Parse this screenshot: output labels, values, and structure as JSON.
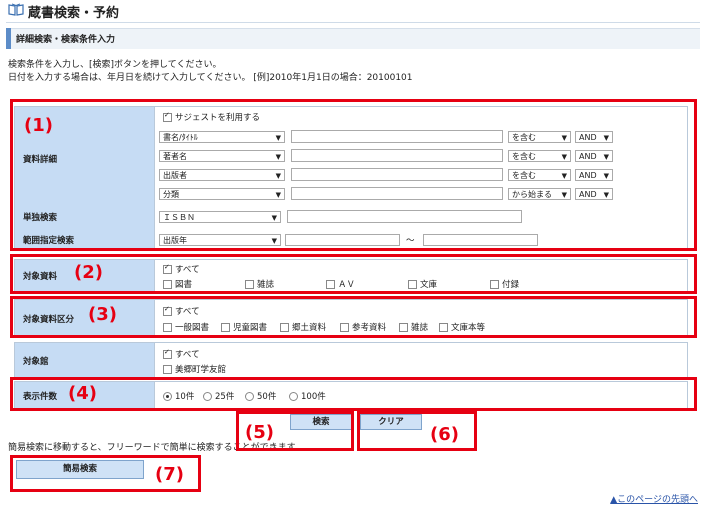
{
  "header": {
    "title": "蔵書検索・予約",
    "subtitle": "詳細検索・検索条件入力"
  },
  "instructions": [
    "検索条件を入力し、[検索]ボタンを押してください。",
    "日付を入力する場合は、年月日を続けて入力してください。 [例]2010年1月1日の場合：20100101"
  ],
  "material_detail": {
    "label": "資料詳細",
    "suggest_label": "サジェストを利用する",
    "rows": [
      {
        "field": "書名/ﾀｲﾄﾙ",
        "match": "を含む",
        "op": "AND"
      },
      {
        "field": "著者名",
        "match": "を含む",
        "op": "AND"
      },
      {
        "field": "出版者",
        "match": "を含む",
        "op": "AND"
      },
      {
        "field": "分類",
        "match": "から始まる",
        "op": "AND"
      }
    ]
  },
  "single_search": {
    "label": "単独検索",
    "field": "ＩＳＢＮ"
  },
  "range_search": {
    "label": "範囲指定検索",
    "field": "出版年",
    "separator": "～"
  },
  "target_material": {
    "label": "対象資料",
    "all": "すべて",
    "options": [
      "図書",
      "雑誌",
      "ＡＶ",
      "文庫",
      "付録"
    ]
  },
  "target_category": {
    "label": "対象資料区分",
    "all": "すべて",
    "options": [
      "一般図書",
      "児童図書",
      "郷土資料",
      "参考資料",
      "雑誌",
      "文庫本等"
    ]
  },
  "target_library": {
    "label": "対象館",
    "all": "すべて",
    "options": [
      "美郷町学友館"
    ]
  },
  "display_count": {
    "label": "表示件数",
    "options": [
      "10件",
      "25件",
      "50件",
      "100件"
    ],
    "selected": "10件"
  },
  "buttons": {
    "search": "検索",
    "clear": "クリア",
    "simple": "簡易検索"
  },
  "simple_note": "簡易検索に移動すると、フリーワードで簡単に検索することができます。",
  "back_to_top": "▲このページの先頭へ",
  "markers": [
    "(1)",
    "(2)",
    "(3)",
    "(4)",
    "(5)",
    "(6)",
    "(7)"
  ],
  "colors": {
    "annotation_red": "#e60012",
    "label_bg": "#c6dcf4",
    "button_bg": "#cfe2f6",
    "link": "#2a54a8"
  }
}
